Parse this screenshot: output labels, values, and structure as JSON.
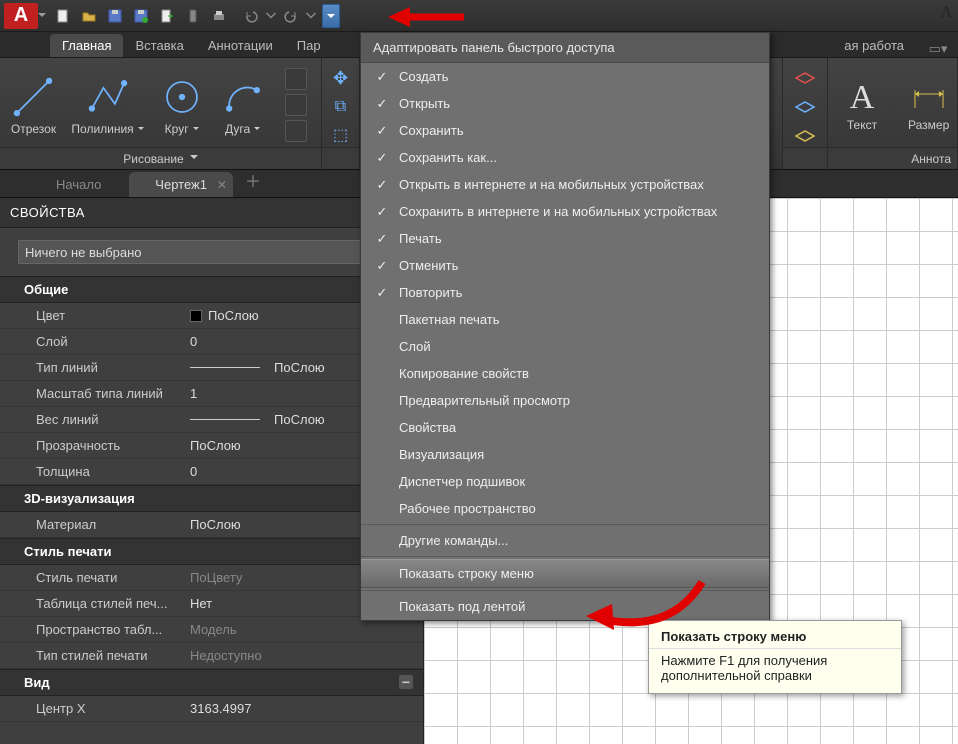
{
  "qat_icons": [
    "new",
    "open",
    "save",
    "saveas",
    "export",
    "mobile",
    "print",
    "undo",
    "redo",
    "redo2"
  ],
  "ribbon_tabs": {
    "main": "Главная",
    "insert": "Вставка",
    "annot": "Аннотации",
    "param": "Пар",
    "collab": "ая работа"
  },
  "draw_panel": {
    "title": "Рисование",
    "tools": {
      "line": "Отрезок",
      "pline": "Полилиния",
      "circle": "Круг",
      "arc": "Дуга"
    }
  },
  "right_panel": {
    "text": "Текст",
    "dim": "Размер",
    "title": "Аннота"
  },
  "dtabs": {
    "start": "Начало",
    "drawing": "Чертеж1"
  },
  "props": {
    "header": "СВОЙСТВА",
    "selection": "Ничего не выбрано",
    "groups": {
      "general": "Общие",
      "viz": "3D-визуализация",
      "plot": "Стиль печати",
      "view": "Вид"
    },
    "rows": {
      "color_l": "Цвет",
      "color_v": "ПоСлою",
      "layer_l": "Слой",
      "layer_v": "0",
      "ltype_l": "Тип линий",
      "ltype_v": "ПоСлою",
      "ltscale_l": "Масштаб типа линий",
      "ltscale_v": "1",
      "lweight_l": "Вес линий",
      "lweight_v": "ПоСлою",
      "transp_l": "Прозрачность",
      "transp_v": "ПоСлою",
      "thick_l": "Толщина",
      "thick_v": "0",
      "material_l": "Материал",
      "material_v": "ПоСлою",
      "pstyle_l": "Стиль печати",
      "pstyle_v": "ПоЦвету",
      "ptable_l": "Таблица стилей печ...",
      "ptable_v": "Нет",
      "pspace_l": "Пространство табл...",
      "pspace_v": "Модель",
      "ptype_l": "Тип стилей печати",
      "ptype_v": "Недоступно",
      "centerx_l": "Центр X",
      "centerx_v": "3163.4997"
    }
  },
  "menu": {
    "title": "Адаптировать панель быстрого доступа",
    "checked": [
      "Создать",
      "Открыть",
      "Сохранить",
      "Сохранить как...",
      "Открыть в интернете и на мобильных устройствах",
      "Сохранить в интернете и на мобильных устройствах",
      "Печать",
      "Отменить",
      "Повторить"
    ],
    "unchecked": [
      "Пакетная печать",
      "Слой",
      "Копирование свойств",
      "Предварительный просмотр",
      "Свойства",
      "Визуализация",
      "Диспетчер подшивок",
      "Рабочее пространство"
    ],
    "other_cmds": "Другие команды...",
    "show_menubar": "Показать строку меню",
    "show_below": "Показать под лентой"
  },
  "tooltip": {
    "title": "Показать строку меню",
    "body": "Нажмите F1 для получения дополнительной справки"
  },
  "top_right": "A"
}
